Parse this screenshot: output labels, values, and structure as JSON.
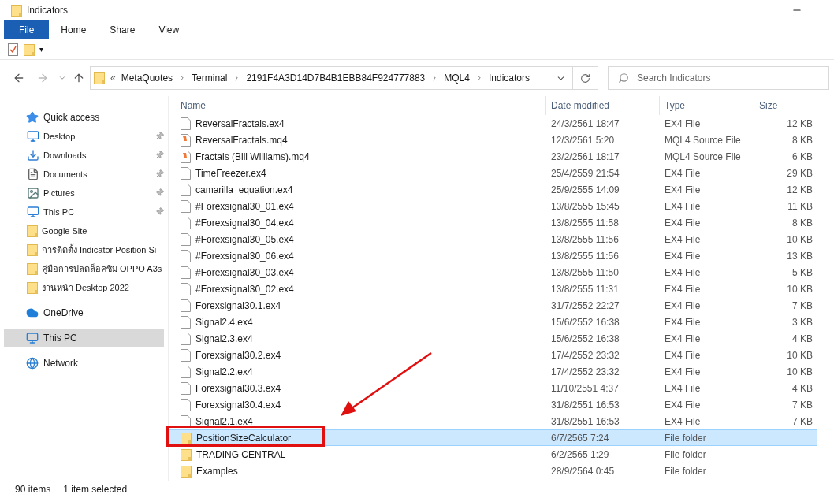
{
  "window": {
    "title": "Indicators"
  },
  "ribbon_tabs": [
    {
      "label": "File",
      "selected": true
    },
    {
      "label": "Home",
      "selected": false
    },
    {
      "label": "Share",
      "selected": false
    },
    {
      "label": "View",
      "selected": false
    }
  ],
  "quick_access_toolbar": {
    "menu_glyph": "▾"
  },
  "address_bar": {
    "overflow": "«",
    "segments": [
      "MetaQuotes",
      "Terminal",
      "2191F4A3D14D7B4B1EBB84F924777883",
      "MQL4",
      "Indicators"
    ]
  },
  "search": {
    "placeholder": "Search Indicators"
  },
  "sidebar": {
    "sections": [
      {
        "label": "Quick access",
        "kind": "quick",
        "selected": false,
        "children": [
          {
            "label": "Desktop",
            "kind": "desktop",
            "pinned": true
          },
          {
            "label": "Downloads",
            "kind": "downloads",
            "pinned": true
          },
          {
            "label": "Documents",
            "kind": "documents",
            "pinned": true
          },
          {
            "label": "Pictures",
            "kind": "pictures",
            "pinned": true
          },
          {
            "label": "This PC",
            "kind": "pc",
            "pinned": true
          },
          {
            "label": "Google Site",
            "kind": "folder",
            "pinned": false
          },
          {
            "label": "การติดตั้ง Indicator Position Si",
            "kind": "folder",
            "pinned": false
          },
          {
            "label": "คู่มือการปลดล็อคซิม OPPO A3s",
            "kind": "folder",
            "pinned": false
          },
          {
            "label": "งานหน้า Desktop 2022",
            "kind": "folder",
            "pinned": false
          }
        ]
      },
      {
        "label": "OneDrive",
        "kind": "cloud",
        "selected": false
      },
      {
        "label": "This PC",
        "kind": "pc",
        "selected": true
      },
      {
        "label": "Network",
        "kind": "network",
        "selected": false
      }
    ]
  },
  "table": {
    "columns": [
      "Name",
      "Date modified",
      "Type",
      "Size"
    ],
    "rows": [
      {
        "name": "ReversalFractals.ex4",
        "date": "24/3/2561 18:47",
        "type": "EX4 File",
        "size": "12 KB",
        "kind": "ex4",
        "selected": false
      },
      {
        "name": "ReversalFractals.mq4",
        "date": "12/3/2561 5:20",
        "type": "MQL4 Source File",
        "size": "8 KB",
        "kind": "mq4",
        "selected": false
      },
      {
        "name": "Fractals (Bill Williams).mq4",
        "date": "23/2/2561 18:17",
        "type": "MQL4 Source File",
        "size": "6 KB",
        "kind": "mq4",
        "selected": false
      },
      {
        "name": "TimeFreezer.ex4",
        "date": "25/4/2559 21:54",
        "type": "EX4 File",
        "size": "29 KB",
        "kind": "ex4",
        "selected": false
      },
      {
        "name": "camarilla_equation.ex4",
        "date": "25/9/2555 14:09",
        "type": "EX4 File",
        "size": "12 KB",
        "kind": "ex4",
        "selected": false
      },
      {
        "name": "#Forexsignal30_01.ex4",
        "date": "13/8/2555 15:45",
        "type": "EX4 File",
        "size": "11 KB",
        "kind": "ex4",
        "selected": false
      },
      {
        "name": "#Forexsignal30_04.ex4",
        "date": "13/8/2555 11:58",
        "type": "EX4 File",
        "size": "8 KB",
        "kind": "ex4",
        "selected": false
      },
      {
        "name": "#Forexsignal30_05.ex4",
        "date": "13/8/2555 11:56",
        "type": "EX4 File",
        "size": "10 KB",
        "kind": "ex4",
        "selected": false
      },
      {
        "name": "#Forexsignal30_06.ex4",
        "date": "13/8/2555 11:56",
        "type": "EX4 File",
        "size": "13 KB",
        "kind": "ex4",
        "selected": false
      },
      {
        "name": "#Forexsignal30_03.ex4",
        "date": "13/8/2555 11:50",
        "type": "EX4 File",
        "size": "5 KB",
        "kind": "ex4",
        "selected": false
      },
      {
        "name": "#Forexsignal30_02.ex4",
        "date": "13/8/2555 11:31",
        "type": "EX4 File",
        "size": "10 KB",
        "kind": "ex4",
        "selected": false
      },
      {
        "name": "Forexsignal30.1.ex4",
        "date": "31/7/2552 22:27",
        "type": "EX4 File",
        "size": "7 KB",
        "kind": "ex4",
        "selected": false
      },
      {
        "name": "Signal2.4.ex4",
        "date": "15/6/2552 16:38",
        "type": "EX4 File",
        "size": "3 KB",
        "kind": "ex4",
        "selected": false
      },
      {
        "name": "Signal2.3.ex4",
        "date": "15/6/2552 16:38",
        "type": "EX4 File",
        "size": "4 KB",
        "kind": "ex4",
        "selected": false
      },
      {
        "name": "Forexsignal30.2.ex4",
        "date": "17/4/2552 23:32",
        "type": "EX4 File",
        "size": "10 KB",
        "kind": "ex4",
        "selected": false
      },
      {
        "name": "Signal2.2.ex4",
        "date": "17/4/2552 23:32",
        "type": "EX4 File",
        "size": "10 KB",
        "kind": "ex4",
        "selected": false
      },
      {
        "name": "Forexsignal30.3.ex4",
        "date": "11/10/2551 4:37",
        "type": "EX4 File",
        "size": "4 KB",
        "kind": "ex4",
        "selected": false
      },
      {
        "name": "Forexsignal30.4.ex4",
        "date": "31/8/2551 16:53",
        "type": "EX4 File",
        "size": "7 KB",
        "kind": "ex4",
        "selected": false
      },
      {
        "name": "Signal2.1.ex4",
        "date": "31/8/2551 16:53",
        "type": "EX4 File",
        "size": "7 KB",
        "kind": "ex4",
        "selected": false
      },
      {
        "name": "PositionSizeCalculator",
        "date": "6/7/2565 7:24",
        "type": "File folder",
        "kind": "folder",
        "selected": true
      },
      {
        "name": "TRADING CENTRAL",
        "date": "6/2/2565 1:29",
        "type": "File folder",
        "kind": "folder",
        "selected": false
      },
      {
        "name": "Examples",
        "date": "28/9/2564 0:45",
        "type": "File folder",
        "kind": "folder",
        "selected": false
      }
    ]
  },
  "status_bar": {
    "item_count": "90 items",
    "selection": "1 item selected"
  }
}
